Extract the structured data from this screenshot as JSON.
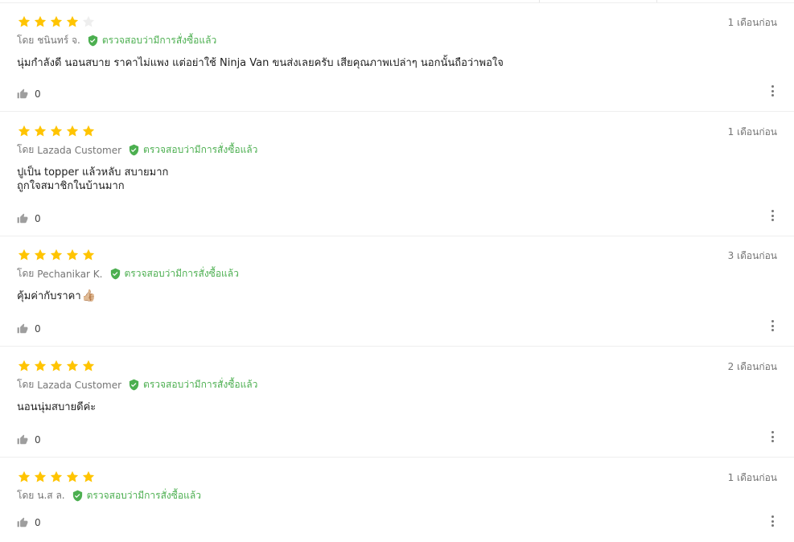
{
  "colors": {
    "star_filled": "#ffc400",
    "star_empty": "#eeeeee",
    "verified": "#4caf50",
    "muted": "#757575"
  },
  "reviews": [
    {
      "rating": 4,
      "date": "1 เดือนก่อน",
      "by_label": "โดย",
      "author": "ชนินทร์ จ.",
      "verified_label": "ตรวจสอบว่ามีการสั่งซื้อแล้ว",
      "content": "นุ่มกำลังดี นอนสบาย ราคาไม่แพง แต่อย่าใช้ Ninja Van ขนส่งเลยครับ เสียคุณภาพเปล่าๆ นอกนั้นถือว่าพอใจ",
      "likes": "0"
    },
    {
      "rating": 5,
      "date": "1 เดือนก่อน",
      "by_label": "โดย",
      "author": "Lazada Customer",
      "verified_label": "ตรวจสอบว่ามีการสั่งซื้อแล้ว",
      "content": "ปูเป็น topper แล้วหลับ สบายมาก\nถูกใจสมาชิกในบ้านมาก",
      "likes": "0"
    },
    {
      "rating": 5,
      "date": "3 เดือนก่อน",
      "by_label": "โดย",
      "author": "Pechanikar K.",
      "verified_label": "ตรวจสอบว่ามีการสั่งซื้อแล้ว",
      "content": "คุ้มค่ากับราคา",
      "emoji": "👍🏼",
      "likes": "0"
    },
    {
      "rating": 5,
      "date": "2 เดือนก่อน",
      "by_label": "โดย",
      "author": "Lazada Customer",
      "verified_label": "ตรวจสอบว่ามีการสั่งซื้อแล้ว",
      "content": "นอนนุ่มสบายดีค่ะ",
      "likes": "0"
    },
    {
      "rating": 5,
      "date": "1 เดือนก่อน",
      "by_label": "โดย",
      "author": "น.ส ล.",
      "verified_label": "ตรวจสอบว่ามีการสั่งซื้อแล้ว",
      "content": "",
      "likes": "0"
    }
  ]
}
